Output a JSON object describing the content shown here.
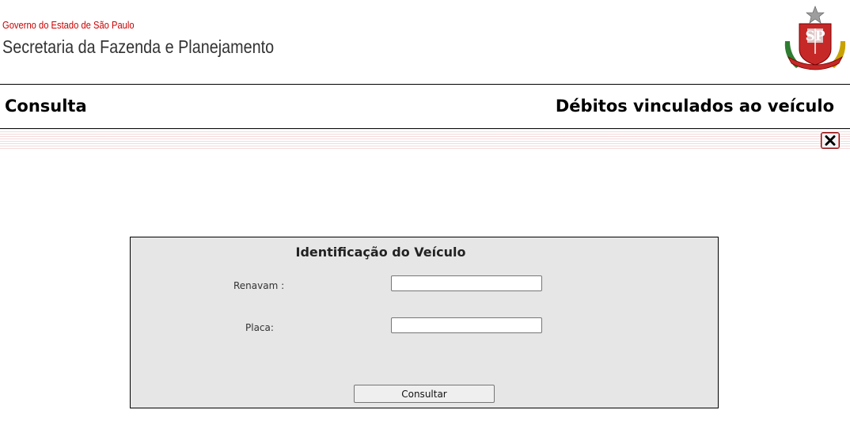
{
  "header": {
    "government_line": "Governo do Estado de São Paulo",
    "secretariat_line": "Secretaria da Fazenda e Planejamento",
    "emblem_icon": "sao-paulo-coat-of-arms",
    "emblem_text": "SP"
  },
  "page": {
    "title_left": "Consulta",
    "title_right": "Débitos vinculados ao veículo",
    "close_icon": "close-x-icon",
    "close_symbol": "✕"
  },
  "form": {
    "title": "Identificação do Veículo",
    "renavam_label": "Renavam :",
    "renavam_value": "",
    "placa_label": "Placa:",
    "placa_value": "",
    "submit_label": "Consultar"
  },
  "colors": {
    "government_red": "#cc0000",
    "panel_background": "#e6e6e6"
  }
}
